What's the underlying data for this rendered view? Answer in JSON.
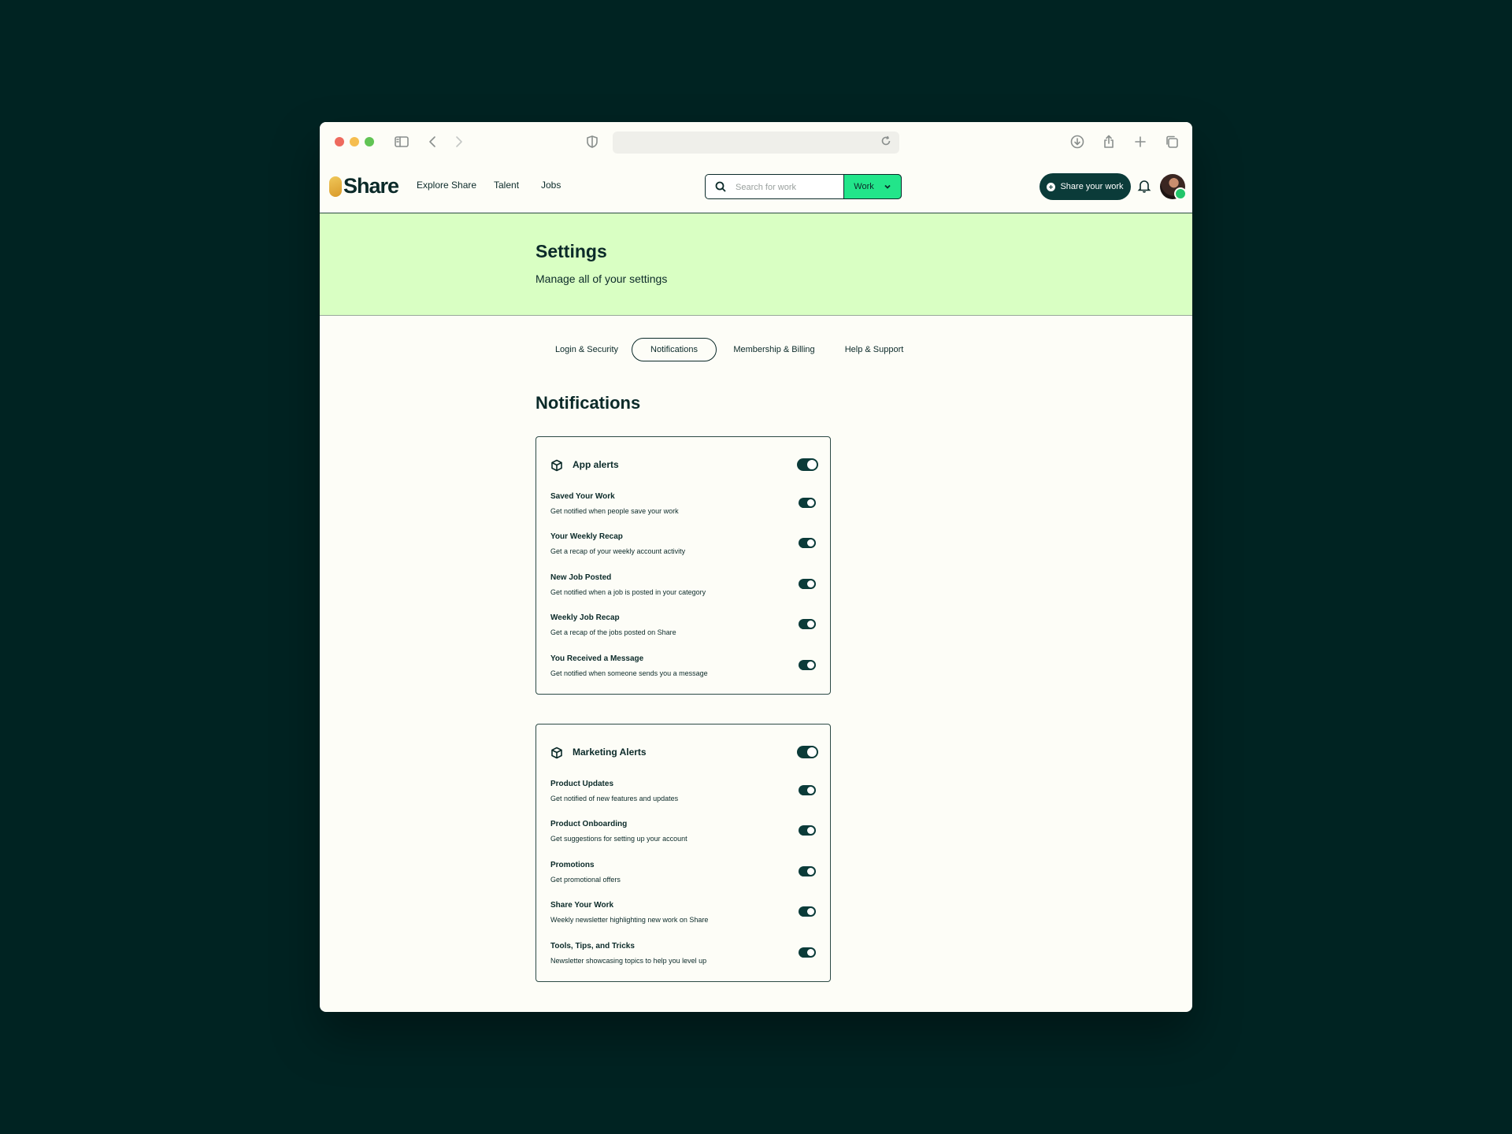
{
  "nav": {
    "logo": "Share",
    "links": [
      "Explore Share",
      "Talent",
      "Jobs"
    ],
    "search_placeholder": "Search for work",
    "search_filter": "Work",
    "share_button": "Share your work"
  },
  "hero": {
    "title": "Settings",
    "subtitle": "Manage all of your settings"
  },
  "tabs": [
    {
      "label": "Login & Security",
      "active": false
    },
    {
      "label": "Notifications",
      "active": true
    },
    {
      "label": "Membership & Billing",
      "active": false
    },
    {
      "label": "Help & Support",
      "active": false
    }
  ],
  "section_title": "Notifications",
  "cards": [
    {
      "title": "App alerts",
      "enabled": true,
      "items": [
        {
          "title": "Saved Your Work",
          "desc": "Get notified when people save your work",
          "enabled": true
        },
        {
          "title": "Your Weekly Recap",
          "desc": "Get a recap of your weekly account activity",
          "enabled": true
        },
        {
          "title": "New Job Posted",
          "desc": "Get notified when a job is posted in your category",
          "enabled": true
        },
        {
          "title": "Weekly Job Recap",
          "desc": "Get a recap of the jobs posted on Share",
          "enabled": true
        },
        {
          "title": "You Received a Message",
          "desc": "Get notified when someone sends you a message",
          "enabled": true
        }
      ]
    },
    {
      "title": "Marketing Alerts",
      "enabled": true,
      "items": [
        {
          "title": "Product Updates",
          "desc": "Get notified of new features and updates",
          "enabled": true
        },
        {
          "title": "Product Onboarding",
          "desc": "Get suggestions for setting up your account",
          "enabled": true
        },
        {
          "title": "Promotions",
          "desc": "Get promotional offers",
          "enabled": true
        },
        {
          "title": "Share Your Work",
          "desc": "Weekly newsletter highlighting new work on Share",
          "enabled": true
        },
        {
          "title": "Tools, Tips, and Tricks",
          "desc": "Newsletter showcasing topics to help you level up",
          "enabled": true
        }
      ]
    }
  ],
  "colors": {
    "background": "#002322",
    "hero": "#d9ffc3",
    "accent_green": "#22e58a",
    "primary_dark": "#0b3b39"
  }
}
